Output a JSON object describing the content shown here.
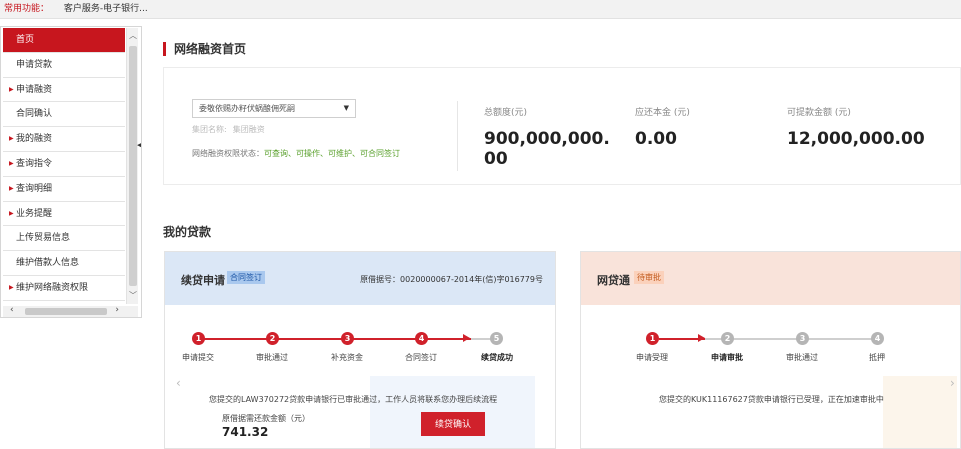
{
  "topbar": {
    "label": "常用功能：",
    "crumb": "客户服务-电子银行..."
  },
  "sidebar": {
    "items": [
      {
        "label": "首页",
        "active": true,
        "arrow": false
      },
      {
        "label": "申请贷款",
        "arrow": false
      },
      {
        "label": "申请融资",
        "arrow": true
      },
      {
        "label": "合同确认",
        "arrow": false
      },
      {
        "label": "我的融资",
        "arrow": true
      },
      {
        "label": "查询指令",
        "arrow": true
      },
      {
        "label": "查询明细",
        "arrow": true
      },
      {
        "label": "业务提醒",
        "arrow": true
      },
      {
        "label": "上传贸易信息",
        "arrow": false
      },
      {
        "label": "维护借款人信息",
        "arrow": false
      },
      {
        "label": "维护网络融资权限",
        "arrow": true
      }
    ]
  },
  "page": {
    "title": "网络融资首页"
  },
  "quota": {
    "select_value": "委敬依赐办籽伏蜗酿佣死嗣",
    "group_label": "集团名称:",
    "group_value": "集团融资",
    "perm_label": "网络融资权限状态：",
    "perm_value": "可查询、可操作、可维护、可合同签订",
    "total_label": "总额度(元)",
    "total_value": "900,000,000.00",
    "repay_label": "应还本金 (元)",
    "repay_value": "0.00",
    "available_label": "可提款金额 (元)",
    "available_value": "12,000,000.00"
  },
  "loans": {
    "section_title": "我的贷款",
    "card1": {
      "title": "续贷申请",
      "tag": "合同签订",
      "orig_no": "原借据号：0020000067-2014年(信)字016779号",
      "steps": [
        "申请提交",
        "审批通过",
        "补充资金",
        "合同签订",
        "续贷成功"
      ],
      "message": "您提交的LAW370272贷款申请银行已审批通过，工作人员将联系您办理后续流程",
      "sub_label": "原借据需还款金额（元）",
      "amount": "741.32",
      "button": "续贷确认"
    },
    "card2": {
      "title": "网贷通",
      "tag": "待审批",
      "steps": [
        "申请受理",
        "申请审批",
        "审批通过",
        "抵押"
      ],
      "message": "您提交的KUK11167627贷款申请银行已受理，正在加速审批中"
    }
  },
  "colors": {
    "accent": "#c7161e",
    "green": "#5aa02c",
    "blue_head": "#dbe7f6",
    "orange_head": "#f9e3da"
  }
}
